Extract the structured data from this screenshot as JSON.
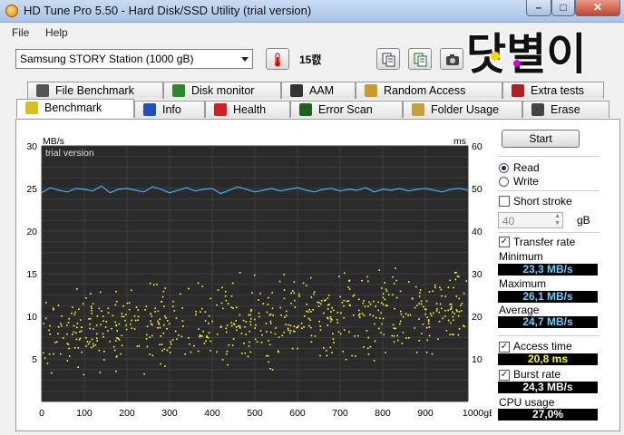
{
  "window": {
    "title": "HD Tune Pro 5.50 - Hard Disk/SSD Utility (trial version)",
    "min_glyph": "–",
    "max_glyph": "□",
    "close_glyph": "✕"
  },
  "menu": {
    "file": "File",
    "help": "Help"
  },
  "toolbar": {
    "drive": "Samsung STORY Station (1000 gB)",
    "temperature": "15캜"
  },
  "watermark": {
    "logo_text": "닷별이"
  },
  "tabs_top": [
    {
      "label": "File Benchmark",
      "icon": "file-benchmark-icon"
    },
    {
      "label": "Disk monitor",
      "icon": "disk-monitor-icon"
    },
    {
      "label": "AAM",
      "icon": "speaker-icon"
    },
    {
      "label": "Random Access",
      "icon": "random-access-icon"
    },
    {
      "label": "Extra tests",
      "icon": "extra-tests-icon"
    }
  ],
  "tabs_bottom": [
    {
      "label": "Benchmark",
      "icon": "benchmark-icon"
    },
    {
      "label": "Info",
      "icon": "info-icon"
    },
    {
      "label": "Health",
      "icon": "health-cross-icon"
    },
    {
      "label": "Error Scan",
      "icon": "magnifier-icon"
    },
    {
      "label": "Folder Usage",
      "icon": "folder-icon"
    },
    {
      "label": "Erase",
      "icon": "trash-icon"
    }
  ],
  "chart": {
    "left_unit": "MB/s",
    "right_unit": "ms",
    "trial_text": "trial version",
    "left_ticks": [
      "30",
      "25",
      "20",
      "15",
      "10",
      "5"
    ],
    "right_ticks": [
      "60",
      "50",
      "40",
      "30",
      "20",
      "10"
    ],
    "x_ticks": [
      "0",
      "100",
      "200",
      "300",
      "400",
      "500",
      "600",
      "700",
      "800",
      "900",
      "1000gB"
    ]
  },
  "chart_data": {
    "type": "line",
    "x_range": [
      0,
      1000
    ],
    "y_range_left": [
      0,
      30
    ],
    "y_range_right": [
      0,
      60
    ],
    "grid": true,
    "series": [
      {
        "axis": "left",
        "color": "#3ab4ff",
        "values": [
          24.5,
          25.1,
          24.8,
          24.6,
          25.0,
          24.9,
          24.7,
          25.3,
          24.5,
          24.9,
          25.0,
          24.8,
          24.6,
          25.2,
          24.9,
          24.5,
          24.8,
          25.1,
          24.7,
          24.9,
          25.0,
          24.4,
          24.8,
          25.2,
          24.9,
          24.6,
          24.8,
          25.0,
          24.7,
          24.9,
          25.1,
          24.8,
          24.6,
          24.9,
          25.0,
          24.7,
          24.9,
          24.8,
          25.1,
          24.6,
          24.9,
          24.8,
          25.0,
          24.7,
          24.9,
          25.0,
          24.8,
          24.6,
          24.9,
          25.0,
          24.8
        ]
      },
      {
        "axis": "right",
        "color": "#ffff33",
        "values": []
      }
    ],
    "access_scatter_ms_range": [
      4,
      34
    ]
  },
  "controls": {
    "start": "Start",
    "read": "Read",
    "write": "Write",
    "short_stroke": "Short stroke",
    "short_stroke_value": "40",
    "gb_unit": "gB",
    "transfer_rate": "Transfer rate",
    "minimum_label": "Minimum",
    "minimum_value": "23,3 MB/s",
    "maximum_label": "Maximum",
    "maximum_value": "26,1 MB/s",
    "average_label": "Average",
    "average_value": "24,7 MB/s",
    "access_time": "Access time",
    "access_time_value": "20,8 ms",
    "burst_rate": "Burst rate",
    "burst_rate_value": "24,3 MB/s",
    "cpu_usage": "CPU usage",
    "cpu_usage_value": "27,0%"
  },
  "colors": {
    "transfer_line": "#3ab4ff",
    "access_dots": "#ffff33",
    "plot_bg": "#2a2a2a"
  }
}
